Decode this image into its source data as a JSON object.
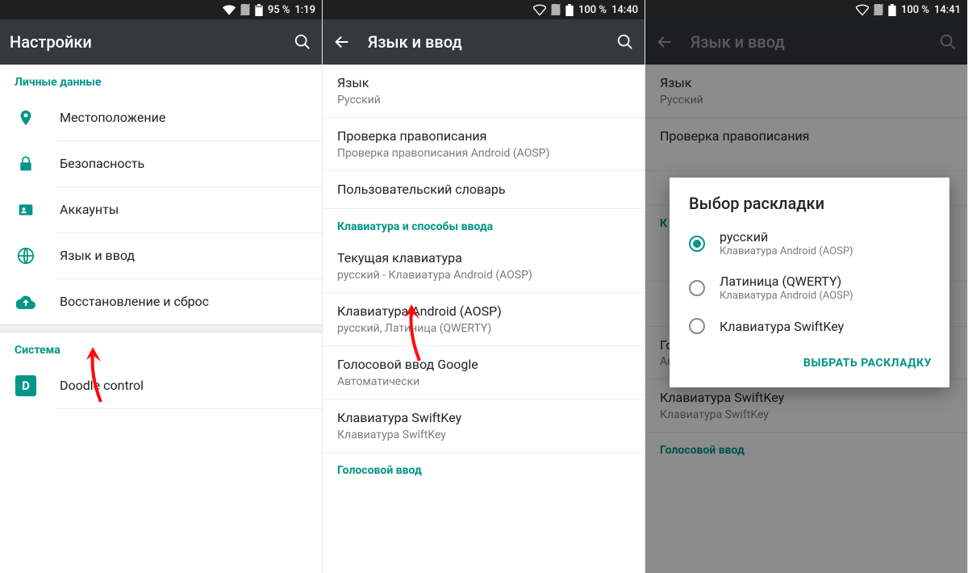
{
  "screen1": {
    "status": {
      "battery": "95 %",
      "time": "1:19"
    },
    "title": "Настройки",
    "section_personal": "Личные данные",
    "items": [
      {
        "label": "Местоположение"
      },
      {
        "label": "Безопасность"
      },
      {
        "label": "Аккаунты"
      },
      {
        "label": "Язык и ввод"
      },
      {
        "label": "Восстановление и сброс"
      }
    ],
    "section_system": "Система",
    "doodle": {
      "badge": "D",
      "label": "Doodle control"
    }
  },
  "screen2": {
    "status": {
      "battery": "100 %",
      "time": "14:40"
    },
    "title": "Язык и ввод",
    "lang_title": "Язык",
    "lang_sub": "Русский",
    "spell_title": "Проверка правописания",
    "spell_sub": "Проверка правописания Android (AOSP)",
    "dict_title": "Пользовательский словарь",
    "kb_header": "Клавиатура и способы ввода",
    "curkb_title": "Текущая клавиатура",
    "curkb_sub": "русский - Клавиатура Android (AOSP)",
    "aosp_title": "Клавиатура Android (AOSP)",
    "aosp_sub": "русский, Латиница (QWERTY)",
    "gvoice_title": "Голосовой ввод Google",
    "gvoice_sub": "Автоматически",
    "swift_title": "Клавиатура SwiftKey",
    "swift_sub": "Клавиатура SwiftKey",
    "voice_header": "Голосовой ввод"
  },
  "screen3": {
    "status": {
      "battery": "100 %",
      "time": "14:41"
    },
    "title": "Язык и ввод",
    "lang_title": "Язык",
    "lang_sub": "Русский",
    "spell_title": "Проверка правописания",
    "kb_header": "К",
    "gvoice_title": "Голосовой ввод Google",
    "gvoice_sub": "Автоматически",
    "swift_title": "Клавиатура SwiftKey",
    "swift_sub": "Клавиатура SwiftKey",
    "voice_header": "Голосовой ввод",
    "dialog": {
      "title": "Выбор раскладки",
      "opt1_t": "русский",
      "opt1_s": "Клавиатура Android (AOSP)",
      "opt2_t": "Латиница (QWERTY)",
      "opt2_s": "Клавиатура Android (AOSP)",
      "opt3_t": "Клавиатура SwiftKey",
      "action": "ВЫБРАТЬ РАСКЛАДКУ"
    }
  }
}
